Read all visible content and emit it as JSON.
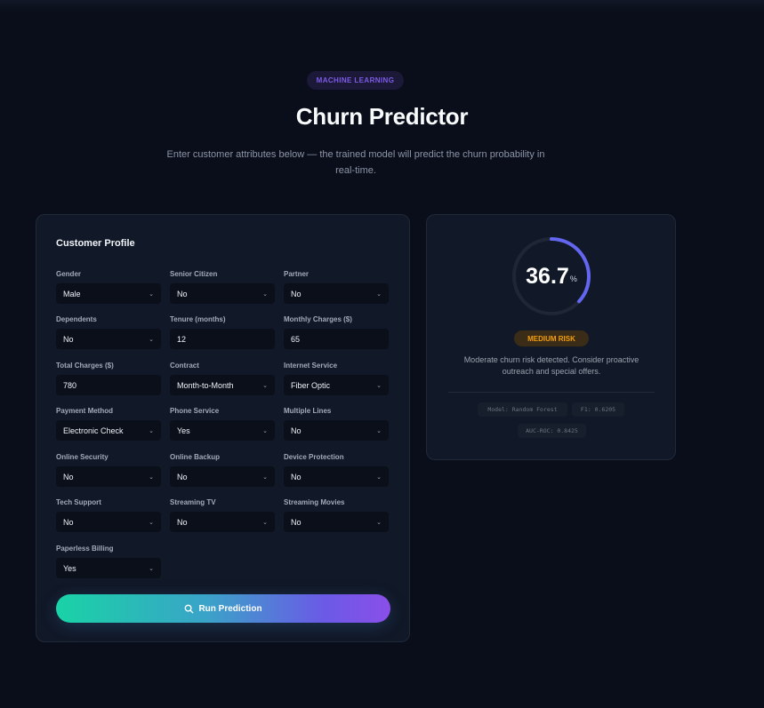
{
  "header": {
    "badge": "MACHINE LEARNING",
    "title": "Churn Predictor",
    "subtitle": "Enter customer attributes below — the trained model will predict the churn probability in real-time."
  },
  "form": {
    "title": "Customer Profile",
    "fields": [
      {
        "label": "Gender",
        "value": "Male",
        "type": "select"
      },
      {
        "label": "Senior Citizen",
        "value": "No",
        "type": "select"
      },
      {
        "label": "Partner",
        "value": "No",
        "type": "select"
      },
      {
        "label": "Dependents",
        "value": "No",
        "type": "select"
      },
      {
        "label": "Tenure (months)",
        "value": "12",
        "type": "input"
      },
      {
        "label": "Monthly Charges ($)",
        "value": "65",
        "type": "input"
      },
      {
        "label": "Total Charges ($)",
        "value": "780",
        "type": "input"
      },
      {
        "label": "Contract",
        "value": "Month-to-Month",
        "type": "select"
      },
      {
        "label": "Internet Service",
        "value": "Fiber Optic",
        "type": "select"
      },
      {
        "label": "Payment Method",
        "value": "Electronic Check",
        "type": "select"
      },
      {
        "label": "Phone Service",
        "value": "Yes",
        "type": "select"
      },
      {
        "label": "Multiple Lines",
        "value": "No",
        "type": "select"
      },
      {
        "label": "Online Security",
        "value": "No",
        "type": "select"
      },
      {
        "label": "Online Backup",
        "value": "No",
        "type": "select"
      },
      {
        "label": "Device Protection",
        "value": "No",
        "type": "select"
      },
      {
        "label": "Tech Support",
        "value": "No",
        "type": "select"
      },
      {
        "label": "Streaming TV",
        "value": "No",
        "type": "select"
      },
      {
        "label": "Streaming Movies",
        "value": "No",
        "type": "select"
      },
      {
        "label": "Paperless Billing",
        "value": "Yes",
        "type": "select"
      }
    ],
    "button_label": "Run Prediction"
  },
  "result": {
    "probability": "36.7",
    "probability_fraction": 0.367,
    "percent_sign": "%",
    "risk_label": "MEDIUM RISK",
    "description": "Moderate churn risk detected. Consider proactive outreach and special offers.",
    "model": "Model: Random Forest",
    "f1": "F1: 0.6205",
    "auc": "AUC-ROC: 0.8425"
  },
  "colors": {
    "background": "#0a0e1a",
    "accent_purple": "#7c5ce6",
    "gauge_color": "#6366f1",
    "risk_color": "#f59e0b",
    "button_start": "#19d3a6",
    "button_end": "#8a4fe8"
  }
}
